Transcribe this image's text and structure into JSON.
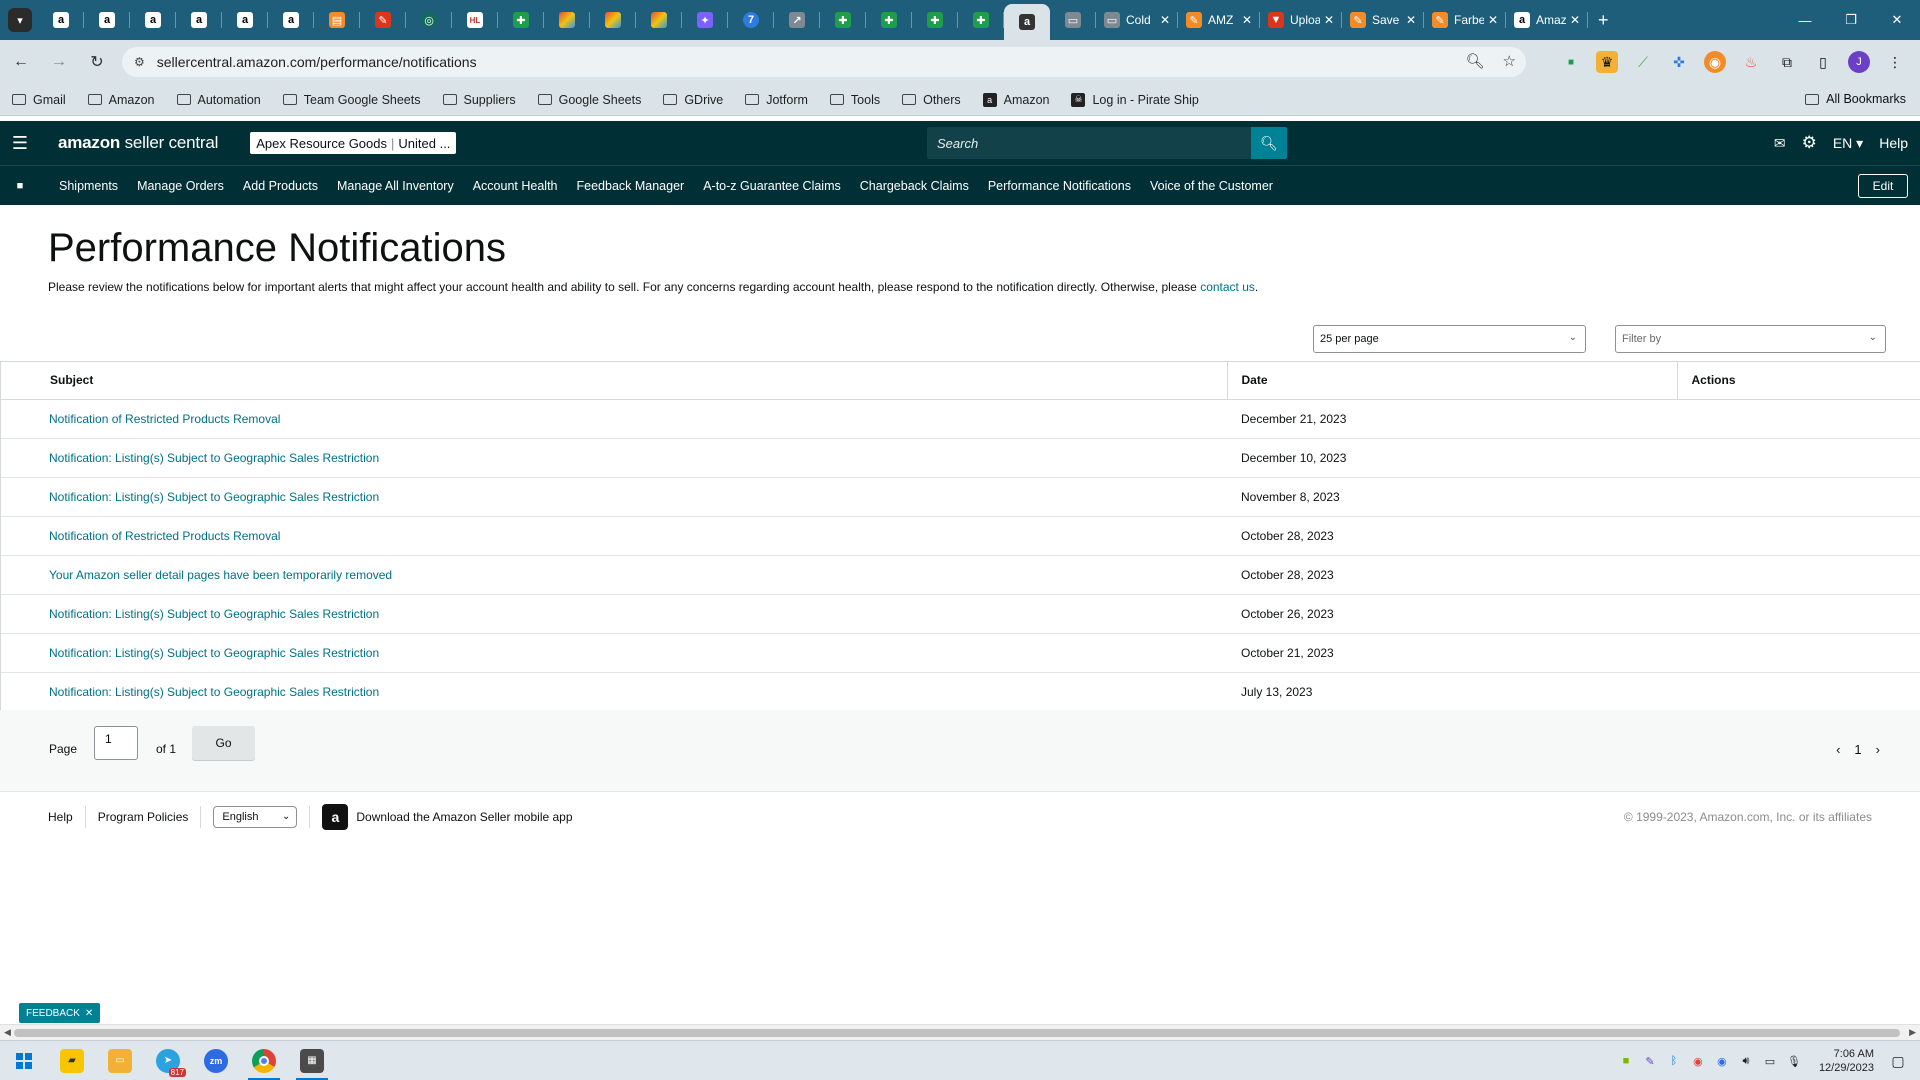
{
  "browser": {
    "pinned_tabs": [
      {
        "icon": "amazon-icon",
        "style": "amz",
        "glyph": "a"
      },
      {
        "icon": "amazon-icon",
        "style": "amz",
        "glyph": "a"
      },
      {
        "icon": "amazon-icon",
        "style": "amz",
        "glyph": "a"
      },
      {
        "icon": "amazon-icon",
        "style": "amz",
        "glyph": "a"
      },
      {
        "icon": "amazon-icon",
        "style": "amz",
        "glyph": "a"
      },
      {
        "icon": "amazon-icon",
        "style": "amz",
        "glyph": "a"
      },
      {
        "icon": "orange-app-icon",
        "style": "orange",
        "glyph": "▤"
      },
      {
        "icon": "feather-icon",
        "style": "red",
        "glyph": "✎"
      },
      {
        "icon": "globe-icon",
        "style": "teal",
        "glyph": "◎"
      },
      {
        "icon": "hl-icon",
        "style": "hl",
        "glyph": "HL"
      },
      {
        "icon": "sheets-icon",
        "style": "green",
        "glyph": "✚"
      },
      {
        "icon": "multicolor-app-icon",
        "style": "multi",
        "glyph": ""
      },
      {
        "icon": "multicolor-app-icon",
        "style": "multi",
        "glyph": ""
      },
      {
        "icon": "multicolor-app-icon",
        "style": "multi",
        "glyph": ""
      },
      {
        "icon": "messenger-icon",
        "style": "purple",
        "glyph": "✦"
      },
      {
        "icon": "number-seven-icon",
        "style": "blue",
        "glyph": "7"
      },
      {
        "icon": "chart-app-icon",
        "style": "gray",
        "glyph": "↗"
      },
      {
        "icon": "sheets-icon",
        "style": "green",
        "glyph": "✚"
      },
      {
        "icon": "sheets-icon",
        "style": "green",
        "glyph": "✚"
      },
      {
        "icon": "sheets-icon",
        "style": "green",
        "glyph": "✚"
      },
      {
        "icon": "sheets-icon",
        "style": "green",
        "glyph": "✚"
      },
      {
        "icon": "amazon-icon",
        "style": "dark",
        "glyph": "a",
        "active": true
      },
      {
        "icon": "drive-icon",
        "style": "gray",
        "glyph": "▭"
      }
    ],
    "tabs": [
      {
        "label": "Cold",
        "icon": "card-icon",
        "style": "gray",
        "glyph": "▭"
      },
      {
        "label": "AMZ",
        "icon": "feather-icon",
        "style": "orange",
        "glyph": "✎"
      },
      {
        "label": "Uploa",
        "icon": "shield-icon",
        "style": "red",
        "glyph": "▼"
      },
      {
        "label": "Save",
        "icon": "feather-icon",
        "style": "orange",
        "glyph": "✎"
      },
      {
        "label": "Farbe",
        "icon": "feather-icon",
        "style": "orange",
        "glyph": "✎"
      },
      {
        "label": "Amaz",
        "icon": "amazon-icon",
        "style": "amz",
        "glyph": "a"
      }
    ],
    "url": "sellercentral.amazon.com/performance/notifications",
    "bookmarks": [
      {
        "label": "Gmail",
        "type": "folder"
      },
      {
        "label": "Amazon",
        "type": "folder"
      },
      {
        "label": "Automation",
        "type": "folder"
      },
      {
        "label": "Team Google Sheets",
        "type": "folder"
      },
      {
        "label": "Suppliers",
        "type": "folder"
      },
      {
        "label": "Google Sheets",
        "type": "folder"
      },
      {
        "label": "GDrive",
        "type": "folder"
      },
      {
        "label": "Jotform",
        "type": "folder"
      },
      {
        "label": "Tools",
        "type": "folder"
      },
      {
        "label": "Others",
        "type": "folder"
      },
      {
        "label": "Amazon",
        "type": "site",
        "glyph": "a"
      },
      {
        "label": "Log in - Pirate Ship",
        "type": "site",
        "glyph": "☠"
      }
    ],
    "all_bookmarks": "All Bookmarks",
    "profile_initial": "J"
  },
  "header": {
    "logo_bold": "amazon",
    "logo_rest": " seller central",
    "account_name": "Apex Resource Goods",
    "account_region": "United ...",
    "search_placeholder": "Search",
    "language": "EN",
    "help": "Help"
  },
  "nav": {
    "items": [
      "Shipments",
      "Manage Orders",
      "Add Products",
      "Manage All Inventory",
      "Account Health",
      "Feedback Manager",
      "A-to-z Guarantee Claims",
      "Chargeback Claims",
      "Performance Notifications",
      "Voice of the Customer"
    ],
    "edit": "Edit"
  },
  "main": {
    "title": "Performance Notifications",
    "description": "Please review the notifications below for important alerts that might affect your account health and ability to sell. For any concerns regarding account health, please respond to the notification directly. Otherwise, please ",
    "contact_link": "contact us",
    "description_end": ".",
    "per_page": "25 per page",
    "filter_placeholder": "Filter by"
  },
  "table": {
    "columns": [
      "Subject",
      "Date",
      "Actions"
    ],
    "rows": [
      {
        "subject": "Notification of Restricted Products Removal",
        "date": "December 21, 2023"
      },
      {
        "subject": "Notification: Listing(s) Subject to Geographic Sales Restriction",
        "date": "December 10, 2023"
      },
      {
        "subject": "Notification: Listing(s) Subject to Geographic Sales Restriction",
        "date": "November 8, 2023"
      },
      {
        "subject": "Notification of Restricted Products Removal",
        "date": "October 28, 2023"
      },
      {
        "subject": "Your Amazon seller detail pages have been temporarily removed",
        "date": "October 28, 2023"
      },
      {
        "subject": "Notification: Listing(s) Subject to Geographic Sales Restriction",
        "date": "October 26, 2023"
      },
      {
        "subject": "Notification: Listing(s) Subject to Geographic Sales Restriction",
        "date": "October 21, 2023"
      },
      {
        "subject": "Notification: Listing(s) Subject to Geographic Sales Restriction",
        "date": "July 13, 2023"
      }
    ]
  },
  "pagination": {
    "page_label": "Page",
    "page_value": "1",
    "of_label": "of 1",
    "go": "Go",
    "current": "1"
  },
  "footer": {
    "help": "Help",
    "policies": "Program Policies",
    "language": "English",
    "app_text": "Download the Amazon Seller mobile app",
    "copyright": "© 1999-2023, Amazon.com, Inc. or its affiliates"
  },
  "feedback": "FEEDBACK",
  "taskbar": {
    "telegram_badge": "817",
    "time": "7:06 AM",
    "date": "12/29/2023"
  },
  "colors": {
    "sc_header": "#002f36",
    "link": "#007185",
    "search_button": "#008296",
    "tab_strip": "#1f5e7a"
  }
}
